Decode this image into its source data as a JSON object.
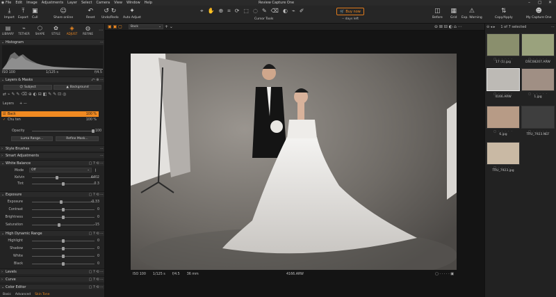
{
  "window": {
    "title": "Review Capture One"
  },
  "menu": [
    "File",
    "Edit",
    "Image",
    "Adjustments",
    "Layer",
    "Select",
    "Camera",
    "View",
    "Window",
    "Help"
  ],
  "toolbar": {
    "import": "Import",
    "export": "Export",
    "cull": "Cull",
    "share": "Share online",
    "reset": "Reset",
    "undo_redo": "Undo/Redo",
    "auto_adjust": "Auto Adjust",
    "cursor_tools": "Cursor Tools",
    "buy_now": "Buy now",
    "days_left": "-- days left",
    "before": "Before",
    "grid": "Grid",
    "exp_warning": "Exp. Warning",
    "copy_apply": "Copy/Apply",
    "my_capture_one": "My Capture One"
  },
  "tool_tabs": [
    {
      "label": "LIBRARY",
      "icon": "library-icon"
    },
    {
      "label": "TETHER",
      "icon": "tether-icon"
    },
    {
      "label": "SHAPE",
      "icon": "shape-icon"
    },
    {
      "label": "STYLE",
      "icon": "style-icon"
    },
    {
      "label": "ADJUST",
      "icon": "adjust-icon",
      "active": true
    },
    {
      "label": "REFINE",
      "icon": "refine-icon"
    }
  ],
  "histogram": {
    "title": "Histogram",
    "iso": "ISO 100",
    "shutter": "1/125 s",
    "aperture": "f/4.5"
  },
  "layers": {
    "title": "Layers & Masks",
    "subject": "Subject",
    "background": "Background",
    "layers_label": "Layers",
    "items": [
      {
        "name": "Back",
        "pct": "100 %",
        "selected": true
      },
      {
        "name": "Chu ten",
        "pct": "100 %",
        "selected": false
      }
    ],
    "opacity_label": "Opacity",
    "opacity_value": "100",
    "opacity_fraction": 1.0,
    "luma_range": "Luma Range...",
    "refine_mask": "Refine Mask..."
  },
  "sections": {
    "style_brushes": "Style Brushes",
    "smart_adjustments": "Smart Adjustments",
    "white_balance": "White Balance",
    "exposure": "Exposure",
    "hdr": "High Dynamic Range",
    "levels": "Levels",
    "curve": "Curve",
    "color_editor": "Color Editor"
  },
  "white_balance": {
    "mode_label": "Mode",
    "mode_value": "Off",
    "kelvin_label": "Kelvin",
    "kelvin_value": "4402",
    "kelvin_fraction": 0.4,
    "tint_label": "Tint",
    "tint_value": "0.3",
    "tint_fraction": 0.5
  },
  "exposure": [
    {
      "label": "Exposure",
      "value": "-0.33",
      "fraction": 0.47
    },
    {
      "label": "Contrast",
      "value": "0",
      "fraction": 0.5
    },
    {
      "label": "Brightness",
      "value": "0",
      "fraction": 0.5
    },
    {
      "label": "Saturation",
      "value": "-15",
      "fraction": 0.43
    }
  ],
  "hdr": [
    {
      "label": "Highlight",
      "value": "0",
      "fraction": 0.5
    },
    {
      "label": "Shadow",
      "value": "0",
      "fraction": 0.5
    },
    {
      "label": "White",
      "value": "0",
      "fraction": 0.5
    },
    {
      "label": "Black",
      "value": "0",
      "fraction": 0.5
    }
  ],
  "color_editor_tabs": [
    {
      "label": "Basic",
      "active": false
    },
    {
      "label": "Advanced",
      "active": false
    },
    {
      "label": "Skin Tone",
      "active": true
    }
  ],
  "viewer": {
    "preset": "Back",
    "caption_iso": "ISO 100",
    "caption_shutter": "1/125 s",
    "caption_aperture": "f/4.5",
    "caption_focal": "36 mm",
    "caption_filename": "4166.ARW"
  },
  "browser": {
    "count_label": "1 of 7 selected",
    "thumbs": [
      {
        "name": "17 (1).jpg",
        "selected": false
      },
      {
        "name": "DSC08207.ARW",
        "selected": false
      },
      {
        "name": "4166.ARW",
        "selected": true
      },
      {
        "name": "1.jpg",
        "selected": false
      },
      {
        "name": "6.jpg",
        "selected": false
      },
      {
        "name": "TRU_7923.NEF",
        "selected": false
      },
      {
        "name": "TRU_7923.jpg",
        "selected": false
      }
    ]
  },
  "colors": {
    "accent": "#f08a22",
    "panel": "#232323",
    "viewer": "#141414"
  }
}
